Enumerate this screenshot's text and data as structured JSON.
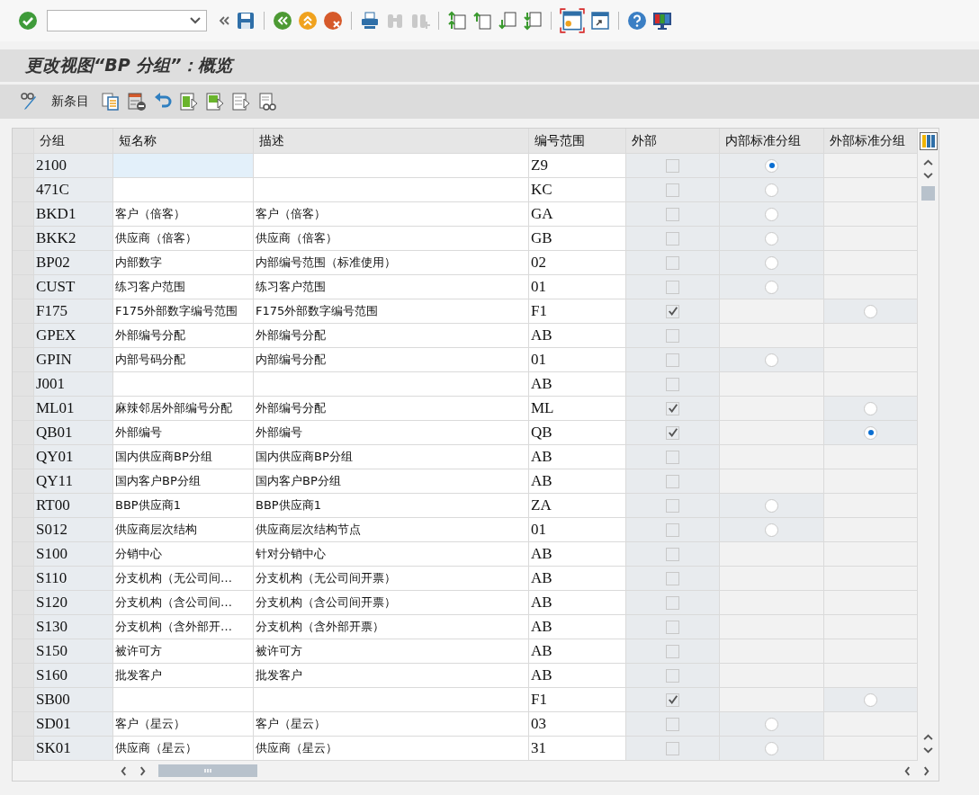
{
  "window": {
    "title": "更改视图“BP 分组”：概览"
  },
  "app_toolbar": {
    "new_entries": "新条目"
  },
  "table": {
    "columns": [
      "分组",
      "短名称",
      "描述",
      "编号范围",
      "外部",
      "内部标准分组",
      "外部标准分组"
    ],
    "rows": [
      {
        "group": "2100",
        "number_range": "Z9",
        "external": false,
        "internal_standard": {
          "selected": true
        },
        "focused": true
      },
      {
        "group": "471C",
        "number_range": "KC",
        "external": false,
        "internal_standard": {
          "selected": false
        },
        "focused": false
      },
      {
        "group": "BKD1",
        "short_name": "客户（倍客）",
        "description": "客户（倍客）",
        "number_range": "GA",
        "external": false,
        "internal_standard": {
          "selected": false
        },
        "focused": false
      },
      {
        "group": "BKK2",
        "short_name": "供应商（倍客）",
        "description": "供应商（倍客）",
        "number_range": "GB",
        "external": false,
        "internal_standard": {
          "selected": false
        },
        "focused": false
      },
      {
        "group": "BP02",
        "short_name": "内部数字",
        "description": "内部编号范围（标准使用）",
        "number_range": "02",
        "external": false,
        "internal_standard": {
          "selected": false
        },
        "focused": false
      },
      {
        "group": "CUST",
        "short_name": "练习客户范围",
        "description": "练习客户范围",
        "number_range": "01",
        "external": false,
        "internal_standard": {
          "selected": false
        },
        "focused": false
      },
      {
        "group": "F175",
        "short_name": "F175外部数字编号范围",
        "description": "F175外部数字编号范围",
        "number_range": "F1",
        "external": true,
        "external_standard": {
          "selected": false
        },
        "focused": false
      },
      {
        "group": "GPEX",
        "short_name": "外部编号分配",
        "description": "外部编号分配",
        "number_range": "AB",
        "external": false,
        "focused": false
      },
      {
        "group": "GPIN",
        "short_name": "内部号码分配",
        "description": "内部编号分配",
        "number_range": "01",
        "external": false,
        "internal_standard": {
          "selected": false
        },
        "focused": false
      },
      {
        "group": "J001",
        "number_range": "AB",
        "external": false,
        "focused": false
      },
      {
        "group": "ML01",
        "short_name": "麻辣邻居外部编号分配",
        "description": "外部编号分配",
        "number_range": "ML",
        "external": true,
        "external_standard": {
          "selected": false
        },
        "focused": false
      },
      {
        "group": "QB01",
        "short_name": "外部编号",
        "description": "外部编号",
        "number_range": "QB",
        "external": true,
        "external_standard": {
          "selected": true
        },
        "focused": false
      },
      {
        "group": "QY01",
        "short_name": "国内供应商BP分组",
        "description": "国内供应商BP分组",
        "number_range": "AB",
        "external": false,
        "focused": false
      },
      {
        "group": "QY11",
        "short_name": "国内客户BP分组",
        "description": "国内客户BP分组",
        "number_range": "AB",
        "external": false,
        "focused": false
      },
      {
        "group": "RT00",
        "short_name": "BBP供应商1",
        "description": "BBP供应商1",
        "number_range": "ZA",
        "external": false,
        "internal_standard": {
          "selected": false
        },
        "focused": false
      },
      {
        "group": "S012",
        "short_name": "供应商层次结构",
        "description": "供应商层次结构节点",
        "number_range": "01",
        "external": false,
        "internal_standard": {
          "selected": false
        },
        "focused": false
      },
      {
        "group": "S100",
        "short_name": "分销中心",
        "description": "针对分销中心",
        "number_range": "AB",
        "external": false,
        "focused": false
      },
      {
        "group": "S110",
        "short_name": "分支机构（无公司间…",
        "description": "分支机构（无公司间开票）",
        "number_range": "AB",
        "external": false,
        "focused": false
      },
      {
        "group": "S120",
        "short_name": "分支机构（含公司间…",
        "description": "分支机构（含公司间开票）",
        "number_range": "AB",
        "external": false,
        "focused": false
      },
      {
        "group": "S130",
        "short_name": "分支机构（含外部开…",
        "description": "分支机构（含外部开票）",
        "number_range": "AB",
        "external": false,
        "focused": false
      },
      {
        "group": "S150",
        "short_name": "被许可方",
        "description": "被许可方",
        "number_range": "AB",
        "external": false,
        "focused": false
      },
      {
        "group": "S160",
        "short_name": "批发客户",
        "description": "批发客户",
        "number_range": "AB",
        "external": false,
        "focused": false
      },
      {
        "group": "SB00",
        "number_range": "F1",
        "external": true,
        "external_standard": {
          "selected": false
        },
        "focused": false
      },
      {
        "group": "SD01",
        "short_name": "客户（星云）",
        "description": "客户（星云）",
        "number_range": "03",
        "external": false,
        "internal_standard": {
          "selected": false
        },
        "focused": false
      },
      {
        "group": "SK01",
        "short_name": "供应商（星云）",
        "description": "供应商（星云）",
        "number_range": "31",
        "external": false,
        "internal_standard": {
          "selected": false
        },
        "focused": false
      }
    ]
  }
}
